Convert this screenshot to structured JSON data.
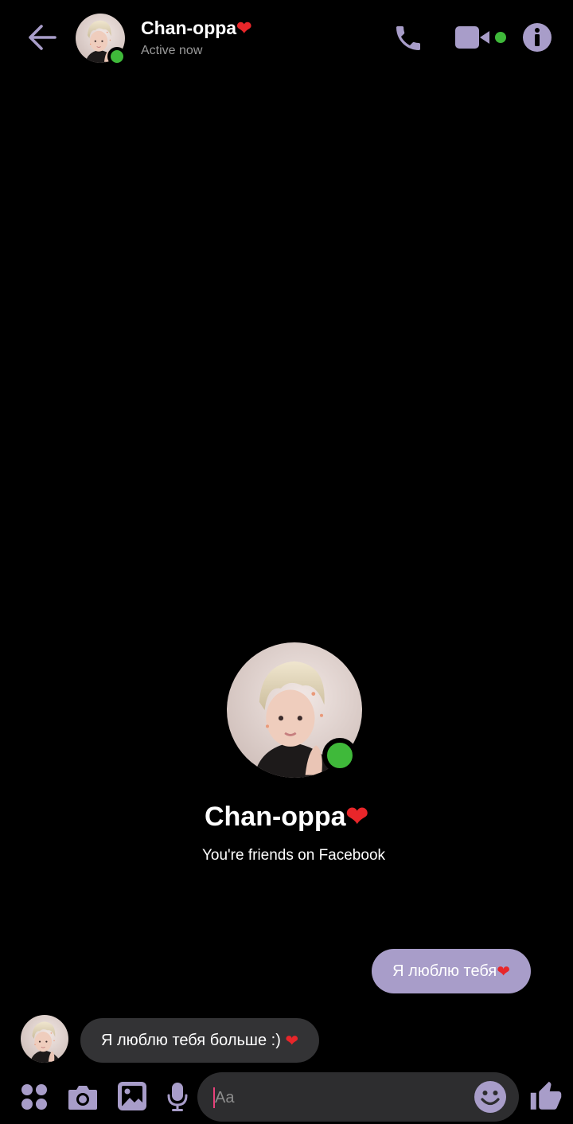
{
  "header": {
    "contact_name": "Chan-oppa",
    "status": "Active now"
  },
  "profile": {
    "name": "Chan-oppa",
    "subtitle": "You're friends on Facebook"
  },
  "messages": [
    {
      "direction": "outgoing",
      "text": "Я люблю тебя"
    },
    {
      "direction": "incoming",
      "text": "Я люблю тебя больше :) "
    }
  ],
  "composer": {
    "placeholder": "Aa"
  },
  "icons": {
    "back": "arrow-left-icon",
    "call": "phone-icon",
    "video": "video-camera-icon",
    "info": "info-icon",
    "apps": "apps-grid-icon",
    "camera": "camera-icon",
    "gallery": "image-icon",
    "mic": "microphone-icon",
    "emoji": "emoji-icon",
    "like": "thumbs-up-icon",
    "heart": "heart-icon"
  },
  "colors": {
    "accent": "#a89dc9",
    "online": "#3fb93a",
    "heart": "#e8262a",
    "incoming_bubble": "#333335",
    "background": "#000000"
  }
}
